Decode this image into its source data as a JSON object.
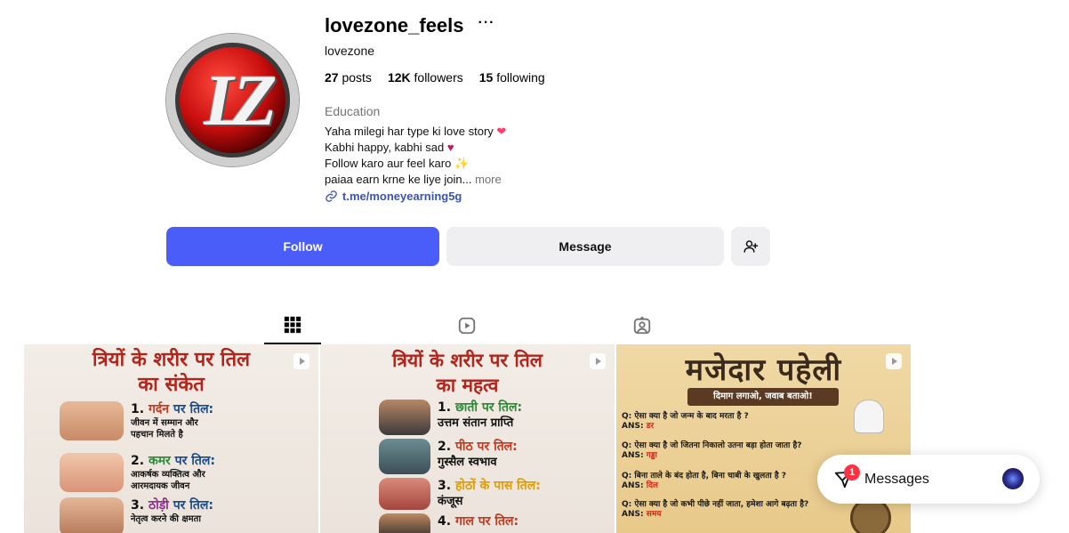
{
  "profile": {
    "username": "lovezone_feels",
    "more_options": "···",
    "full_name": "lovezone",
    "avatar_letters": "LZ",
    "stats": {
      "posts_count": "27",
      "posts_label": "posts",
      "followers_count": "12K",
      "followers_label": "followers",
      "following_count": "15",
      "following_label": "following"
    },
    "category": "Education",
    "bio_lines": [
      {
        "text": "Yaha milegi har type ki love story ",
        "emoji": "❤"
      },
      {
        "text": "Kabhi happy, kabhi sad ",
        "emoji": "♥"
      },
      {
        "text": "Follow karo aur feel karo ",
        "emoji": "✨"
      },
      {
        "text": "paiaa earn krne ke liye join... ",
        "more": "more"
      }
    ],
    "link": "t.me/moneyearning5g"
  },
  "actions": {
    "follow_label": "Follow",
    "message_label": "Message"
  },
  "tabs": [
    "posts",
    "reels",
    "tagged"
  ],
  "posts": [
    {
      "title_line1": "त्रियों के शरीर पर तिल",
      "title_line2": "का संकेत",
      "items": [
        {
          "num": "1.",
          "key": "गर्दन",
          "rest": " पर तिल:",
          "sub1": "जीवन में सम्मान और",
          "sub2": "पहचान मिलते है"
        },
        {
          "num": "2.",
          "key": "कमर",
          "rest": " पर तिल:",
          "sub1": "आकर्षक व्यक्तित्व और",
          "sub2": "आरमदायक जीवन"
        },
        {
          "num": "3.",
          "key": "ठोड़ी",
          "rest": " पर तिल:",
          "sub1": "नेतृत्व करने की क्षमता",
          "sub2": ""
        }
      ]
    },
    {
      "title_line1": "त्रियों के शरीर पर तिल",
      "title_line2": "का महत्व",
      "items": [
        {
          "num": "1.",
          "key": "छाती पर तिल:",
          "sub1": "उत्तम संतान प्राप्ति"
        },
        {
          "num": "2.",
          "key": "पीठ पर तिल:",
          "sub1": "गुस्सैल स्वभाव"
        },
        {
          "num": "3.",
          "key": "होठों के पास तिल:",
          "sub1": "कंजूस"
        },
        {
          "num": "4.",
          "key": "गाल पर तिल:",
          "sub1": ""
        }
      ]
    },
    {
      "title": "मजेदार पहेली",
      "subtitle": "दिमाग लगाओ, जवाब बताओ!",
      "qa": [
        {
          "q": "Q: ऐसा क्या है जो जन्म के बाद मरता है ?",
          "ans_label": "ANS:",
          "ans": "डर"
        },
        {
          "q": "Q: ऐसा क्या है जो जितना निकालो उतना बड़ा होता जाता है?",
          "ans_label": "ANS:",
          "ans": "गड्ढा"
        },
        {
          "q": "Q: बिना ताले के बंद होता है, बिना चाबी के खुलता है ?",
          "ans_label": "ANS:",
          "ans": "दिल"
        },
        {
          "q": "Q: ऐसा क्या है जो कभी पीछे नहीं जाता, हमेशा आगे बढ़ता है?",
          "ans_label": "ANS:",
          "ans": "समय"
        }
      ]
    }
  ],
  "messages_widget": {
    "label": "Messages",
    "badge": "1"
  }
}
